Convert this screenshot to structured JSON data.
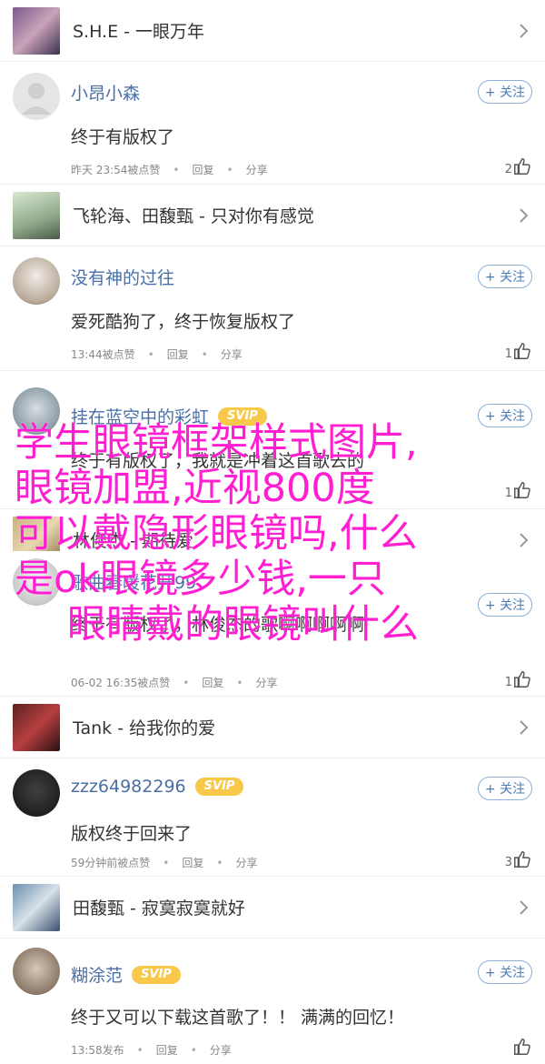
{
  "follow_label": "+ 关注",
  "reply_label": "回复",
  "share_label": "分享",
  "songs": [
    {
      "title": "S.H.E - 一眼万年"
    },
    {
      "title": "飞轮海、田馥甄 - 只对你有感觉"
    },
    {
      "title": "林俊杰 - 期待爱"
    },
    {
      "title": "Tank - 给我你的爱"
    },
    {
      "title": "田馥甄 - 寂寞寂寞就好"
    }
  ],
  "comments": [
    {
      "user": "小昂小森",
      "text": "终于有版权了",
      "time": "昨天 23:54",
      "suffix": "被点赞",
      "likes": "2",
      "svip": false
    },
    {
      "user": "没有神的过往",
      "text": "爱死酷狗了，终于恢复版权了",
      "time": "13:44",
      "suffix": "被点赞",
      "likes": "1",
      "svip": false
    },
    {
      "user": "挂在蓝空中的彩虹",
      "text": "终于有版权了，我就是冲着这首歌去的",
      "time": "",
      "suffix": "",
      "likes": "1",
      "svip": true
    },
    {
      "user": "歌曲春暖花开99",
      "text": "终于有版权了，林俊杰的歌啊啊啊啊啊",
      "time": "06-02 16:35",
      "suffix": "被点赞",
      "likes": "1",
      "svip": false
    },
    {
      "user": "zzz64982296",
      "text": "版权终于回来了",
      "time": "59分钟前",
      "suffix": "被点赞",
      "likes": "3",
      "svip": true
    },
    {
      "user": "糊涂范",
      "text": "终于又可以下载这首歌了！！ 满满的回忆！",
      "time": "13:58",
      "suffix": "发布",
      "likes": "",
      "svip": true
    }
  ],
  "svip_label": "SVIP",
  "overlay": {
    "lines": [
      "学生眼镜框架样式图片,",
      "眼镜加盟,近视800度",
      "可以戴隐形眼镜吗,什么",
      "是ok眼镜多少钱,一只",
      "眼睛戴的眼镜叫什么"
    ]
  }
}
